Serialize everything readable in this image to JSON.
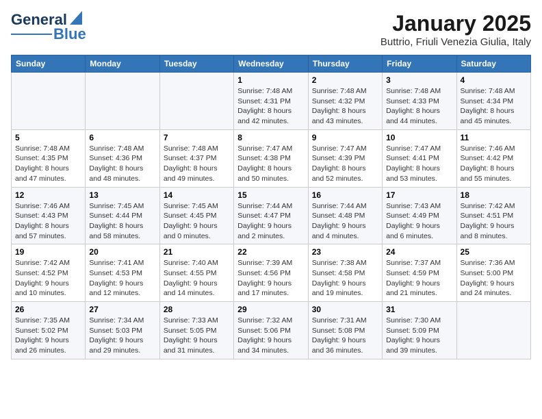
{
  "logo": {
    "text_general": "General",
    "text_blue": "Blue"
  },
  "title": "January 2025",
  "subtitle": "Buttrio, Friuli Venezia Giulia, Italy",
  "days_of_week": [
    "Sunday",
    "Monday",
    "Tuesday",
    "Wednesday",
    "Thursday",
    "Friday",
    "Saturday"
  ],
  "weeks": [
    [
      {
        "day": "",
        "sunrise": "",
        "sunset": "",
        "daylight": ""
      },
      {
        "day": "",
        "sunrise": "",
        "sunset": "",
        "daylight": ""
      },
      {
        "day": "",
        "sunrise": "",
        "sunset": "",
        "daylight": ""
      },
      {
        "day": "1",
        "sunrise": "Sunrise: 7:48 AM",
        "sunset": "Sunset: 4:31 PM",
        "daylight": "Daylight: 8 hours and 42 minutes."
      },
      {
        "day": "2",
        "sunrise": "Sunrise: 7:48 AM",
        "sunset": "Sunset: 4:32 PM",
        "daylight": "Daylight: 8 hours and 43 minutes."
      },
      {
        "day": "3",
        "sunrise": "Sunrise: 7:48 AM",
        "sunset": "Sunset: 4:33 PM",
        "daylight": "Daylight: 8 hours and 44 minutes."
      },
      {
        "day": "4",
        "sunrise": "Sunrise: 7:48 AM",
        "sunset": "Sunset: 4:34 PM",
        "daylight": "Daylight: 8 hours and 45 minutes."
      }
    ],
    [
      {
        "day": "5",
        "sunrise": "Sunrise: 7:48 AM",
        "sunset": "Sunset: 4:35 PM",
        "daylight": "Daylight: 8 hours and 47 minutes."
      },
      {
        "day": "6",
        "sunrise": "Sunrise: 7:48 AM",
        "sunset": "Sunset: 4:36 PM",
        "daylight": "Daylight: 8 hours and 48 minutes."
      },
      {
        "day": "7",
        "sunrise": "Sunrise: 7:48 AM",
        "sunset": "Sunset: 4:37 PM",
        "daylight": "Daylight: 8 hours and 49 minutes."
      },
      {
        "day": "8",
        "sunrise": "Sunrise: 7:47 AM",
        "sunset": "Sunset: 4:38 PM",
        "daylight": "Daylight: 8 hours and 50 minutes."
      },
      {
        "day": "9",
        "sunrise": "Sunrise: 7:47 AM",
        "sunset": "Sunset: 4:39 PM",
        "daylight": "Daylight: 8 hours and 52 minutes."
      },
      {
        "day": "10",
        "sunrise": "Sunrise: 7:47 AM",
        "sunset": "Sunset: 4:41 PM",
        "daylight": "Daylight: 8 hours and 53 minutes."
      },
      {
        "day": "11",
        "sunrise": "Sunrise: 7:46 AM",
        "sunset": "Sunset: 4:42 PM",
        "daylight": "Daylight: 8 hours and 55 minutes."
      }
    ],
    [
      {
        "day": "12",
        "sunrise": "Sunrise: 7:46 AM",
        "sunset": "Sunset: 4:43 PM",
        "daylight": "Daylight: 8 hours and 57 minutes."
      },
      {
        "day": "13",
        "sunrise": "Sunrise: 7:45 AM",
        "sunset": "Sunset: 4:44 PM",
        "daylight": "Daylight: 8 hours and 58 minutes."
      },
      {
        "day": "14",
        "sunrise": "Sunrise: 7:45 AM",
        "sunset": "Sunset: 4:45 PM",
        "daylight": "Daylight: 9 hours and 0 minutes."
      },
      {
        "day": "15",
        "sunrise": "Sunrise: 7:44 AM",
        "sunset": "Sunset: 4:47 PM",
        "daylight": "Daylight: 9 hours and 2 minutes."
      },
      {
        "day": "16",
        "sunrise": "Sunrise: 7:44 AM",
        "sunset": "Sunset: 4:48 PM",
        "daylight": "Daylight: 9 hours and 4 minutes."
      },
      {
        "day": "17",
        "sunrise": "Sunrise: 7:43 AM",
        "sunset": "Sunset: 4:49 PM",
        "daylight": "Daylight: 9 hours and 6 minutes."
      },
      {
        "day": "18",
        "sunrise": "Sunrise: 7:42 AM",
        "sunset": "Sunset: 4:51 PM",
        "daylight": "Daylight: 9 hours and 8 minutes."
      }
    ],
    [
      {
        "day": "19",
        "sunrise": "Sunrise: 7:42 AM",
        "sunset": "Sunset: 4:52 PM",
        "daylight": "Daylight: 9 hours and 10 minutes."
      },
      {
        "day": "20",
        "sunrise": "Sunrise: 7:41 AM",
        "sunset": "Sunset: 4:53 PM",
        "daylight": "Daylight: 9 hours and 12 minutes."
      },
      {
        "day": "21",
        "sunrise": "Sunrise: 7:40 AM",
        "sunset": "Sunset: 4:55 PM",
        "daylight": "Daylight: 9 hours and 14 minutes."
      },
      {
        "day": "22",
        "sunrise": "Sunrise: 7:39 AM",
        "sunset": "Sunset: 4:56 PM",
        "daylight": "Daylight: 9 hours and 17 minutes."
      },
      {
        "day": "23",
        "sunrise": "Sunrise: 7:38 AM",
        "sunset": "Sunset: 4:58 PM",
        "daylight": "Daylight: 9 hours and 19 minutes."
      },
      {
        "day": "24",
        "sunrise": "Sunrise: 7:37 AM",
        "sunset": "Sunset: 4:59 PM",
        "daylight": "Daylight: 9 hours and 21 minutes."
      },
      {
        "day": "25",
        "sunrise": "Sunrise: 7:36 AM",
        "sunset": "Sunset: 5:00 PM",
        "daylight": "Daylight: 9 hours and 24 minutes."
      }
    ],
    [
      {
        "day": "26",
        "sunrise": "Sunrise: 7:35 AM",
        "sunset": "Sunset: 5:02 PM",
        "daylight": "Daylight: 9 hours and 26 minutes."
      },
      {
        "day": "27",
        "sunrise": "Sunrise: 7:34 AM",
        "sunset": "Sunset: 5:03 PM",
        "daylight": "Daylight: 9 hours and 29 minutes."
      },
      {
        "day": "28",
        "sunrise": "Sunrise: 7:33 AM",
        "sunset": "Sunset: 5:05 PM",
        "daylight": "Daylight: 9 hours and 31 minutes."
      },
      {
        "day": "29",
        "sunrise": "Sunrise: 7:32 AM",
        "sunset": "Sunset: 5:06 PM",
        "daylight": "Daylight: 9 hours and 34 minutes."
      },
      {
        "day": "30",
        "sunrise": "Sunrise: 7:31 AM",
        "sunset": "Sunset: 5:08 PM",
        "daylight": "Daylight: 9 hours and 36 minutes."
      },
      {
        "day": "31",
        "sunrise": "Sunrise: 7:30 AM",
        "sunset": "Sunset: 5:09 PM",
        "daylight": "Daylight: 9 hours and 39 minutes."
      },
      {
        "day": "",
        "sunrise": "",
        "sunset": "",
        "daylight": ""
      }
    ]
  ]
}
